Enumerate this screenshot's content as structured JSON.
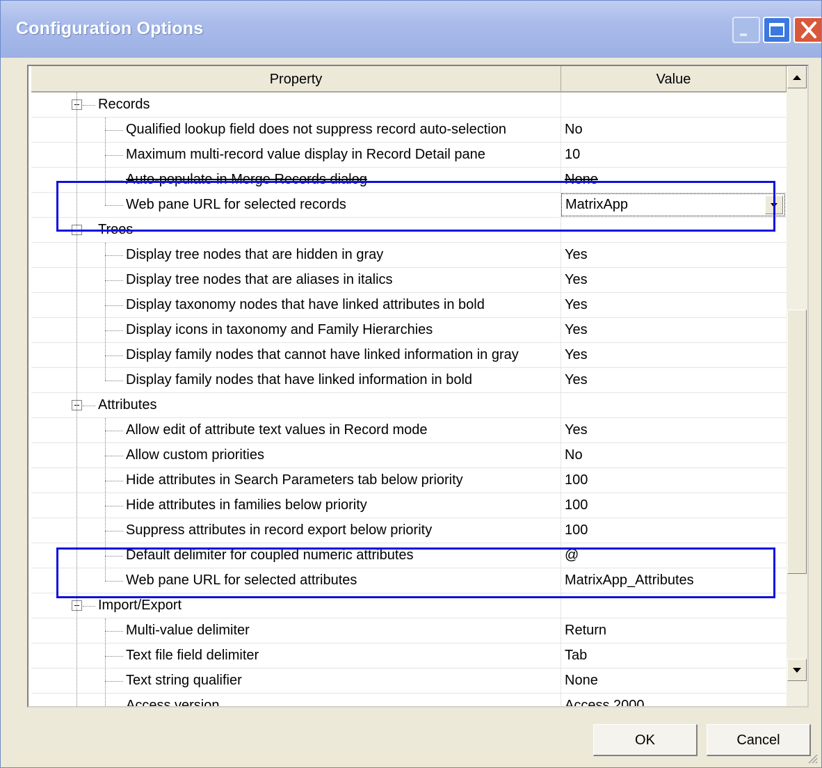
{
  "window": {
    "title": "Configuration Options"
  },
  "grid": {
    "columns": {
      "property": "Property",
      "value": "Value"
    },
    "rows": [
      {
        "type": "category",
        "label": "Records"
      },
      {
        "type": "item",
        "label": "Qualified lookup field does not suppress record auto-selection",
        "value": "No"
      },
      {
        "type": "item",
        "label": "Maximum multi-record value display in Record Detail pane",
        "value": "10"
      },
      {
        "type": "item",
        "label": "Auto-populate in Merge Records dialog",
        "value": "None"
      },
      {
        "type": "item",
        "label": "Web pane URL for selected records",
        "value": "MatrixApp"
      },
      {
        "type": "category",
        "label": "Trees"
      },
      {
        "type": "item",
        "label": "Display tree nodes that are hidden in gray",
        "value": "Yes"
      },
      {
        "type": "item",
        "label": "Display tree nodes that are aliases in italics",
        "value": "Yes"
      },
      {
        "type": "item",
        "label": "Display taxonomy nodes that have linked attributes in bold",
        "value": "Yes"
      },
      {
        "type": "item",
        "label": "Display icons in taxonomy and Family Hierarchies",
        "value": "Yes"
      },
      {
        "type": "item",
        "label": "Display family nodes that cannot have linked information in gray",
        "value": "Yes"
      },
      {
        "type": "item",
        "label": "Display family nodes that have linked information in bold",
        "value": "Yes"
      },
      {
        "type": "category",
        "label": "Attributes"
      },
      {
        "type": "item",
        "label": "Allow edit of attribute text values in Record mode",
        "value": "Yes"
      },
      {
        "type": "item",
        "label": "Allow custom priorities",
        "value": "No"
      },
      {
        "type": "item",
        "label": "Hide attributes in Search Parameters tab below priority",
        "value": "100"
      },
      {
        "type": "item",
        "label": "Hide attributes in families below priority",
        "value": "100"
      },
      {
        "type": "item",
        "label": "Suppress attributes in record export below priority",
        "value": "100"
      },
      {
        "type": "item",
        "label": "Default delimiter for coupled numeric attributes",
        "value": " @"
      },
      {
        "type": "item",
        "label": "Web pane URL for selected attributes",
        "value": "MatrixApp_Attributes"
      },
      {
        "type": "category",
        "label": "Import/Export"
      },
      {
        "type": "item",
        "label": "Multi-value delimiter",
        "value": "Return"
      },
      {
        "type": "item",
        "label": "Text file field delimiter",
        "value": "Tab"
      },
      {
        "type": "item",
        "label": "Text string qualifier",
        "value": "None"
      },
      {
        "type": "item",
        "label": "Access version",
        "value": "Access 2000"
      }
    ]
  },
  "buttons": {
    "ok": "OK",
    "cancel": "Cancel"
  },
  "colors": {
    "highlight": "#1010e0",
    "titlebar": "#9cb0e4",
    "dialog": "#ece9d8"
  }
}
